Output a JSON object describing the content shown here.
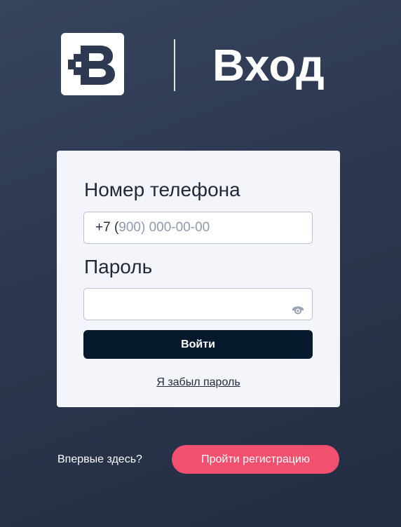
{
  "header": {
    "title": "Вход",
    "logo": "logo-icon"
  },
  "form": {
    "phone": {
      "label": "Номер телефона",
      "prefix": "+7 (",
      "mask": "900) 000-00-00"
    },
    "password": {
      "label": "Пароль",
      "value": "",
      "icon": "eye-icon"
    },
    "login_button": "Войти",
    "forgot_link": "Я забыл пароль"
  },
  "footer": {
    "prompt": "Впервые здесь?",
    "register_button": "Пройти регистрацию"
  },
  "colors": {
    "background": "#2c3850",
    "card": "#f3f5fa",
    "primary_button": "#07192c",
    "accent": "#f2506f"
  }
}
